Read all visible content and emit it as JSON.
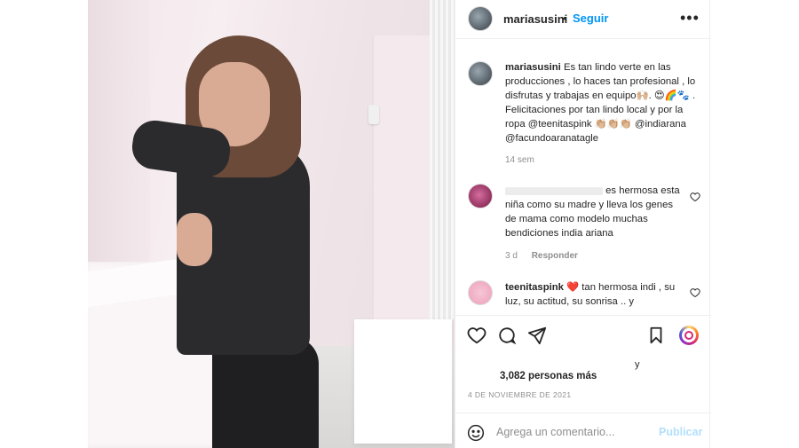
{
  "header": {
    "username": "mariasusini",
    "separator": "•",
    "follow_label": "Seguir",
    "more_icon": "more-horizontal-icon"
  },
  "caption": {
    "username": "mariasusini",
    "text": "Es tan lindo verte en las producciones , lo haces tan profesional , lo disfrutas y trabajas en equipo🙌🏼. 😍🌈🐾 . Felicitaciones por tan lindo local y por la ropa @teenitaspink 👏🏼👏🏼👏🏼 @indiarana @facundoaranatagle",
    "time": "14 sem"
  },
  "comments": [
    {
      "username": "",
      "text": "es hermosa esta niña como su madre y lleva los genes de mama como modelo muchas bendiciones india ariana",
      "time": "3 d",
      "reply_label": "Responder"
    },
    {
      "username": "teenitaspink",
      "text": "❤️ tan hermosa indi , su luz, su actitud, su sonrisa .. y"
    }
  ],
  "actions": {
    "like_icon": "heart-icon",
    "comment_icon": "comment-icon",
    "share_icon": "send-icon",
    "save_icon": "bookmark-icon"
  },
  "likes": {
    "connector": "y",
    "count_text": "3,082 personas más"
  },
  "date": "4 DE NOVIEMBRE DE 2021",
  "add_comment": {
    "placeholder": "Agrega un comentario...",
    "publish_label": "Publicar"
  },
  "colors": {
    "accent": "#0095f6",
    "publish_disabled": "#b2dffc",
    "muted": "#8e8e8e",
    "border": "#efefef"
  }
}
